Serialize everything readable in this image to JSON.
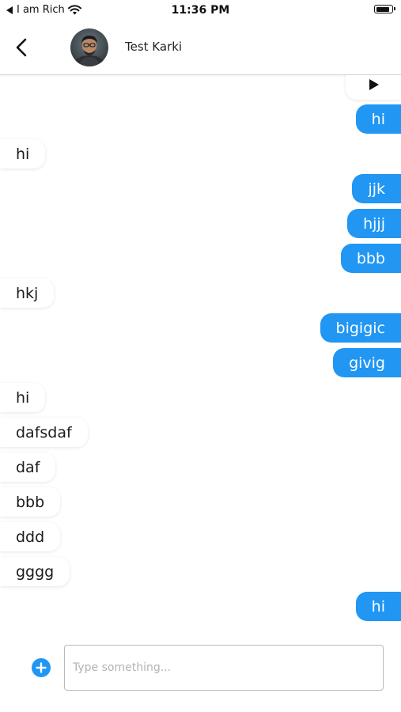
{
  "status_bar": {
    "back_app": "I am Rich",
    "time": "11:36 PM",
    "battery_level": 0.9
  },
  "header": {
    "contact_name": "Test Karki"
  },
  "messages": [
    {
      "dir": "out",
      "text": "hi"
    },
    {
      "dir": "in",
      "text": "hi"
    },
    {
      "dir": "out",
      "text": "jjk"
    },
    {
      "dir": "out",
      "text": "hjjj"
    },
    {
      "dir": "out",
      "text": "bbb"
    },
    {
      "dir": "in",
      "text": "hkj"
    },
    {
      "dir": "out",
      "text": "bigigic"
    },
    {
      "dir": "out",
      "text": "givig"
    },
    {
      "dir": "in",
      "text": "hi"
    },
    {
      "dir": "in",
      "text": "dafsdaf"
    },
    {
      "dir": "in",
      "text": "daf"
    },
    {
      "dir": "in",
      "text": "bbb"
    },
    {
      "dir": "in",
      "text": "ddd"
    },
    {
      "dir": "in",
      "text": "gggg"
    },
    {
      "dir": "out",
      "text": "hi"
    }
  ],
  "composer": {
    "placeholder": "Type something...",
    "value": ""
  },
  "colors": {
    "outgoing_bubble": "#2196F3",
    "incoming_bubble": "#ffffff",
    "accent": "#2196F3"
  },
  "icons": {
    "back": "chevron-left-icon",
    "play": "play-icon",
    "add": "plus-circle-icon",
    "wifi": "wifi-icon",
    "back_arrow_small": "triangle-left-icon",
    "battery": "battery-icon"
  }
}
